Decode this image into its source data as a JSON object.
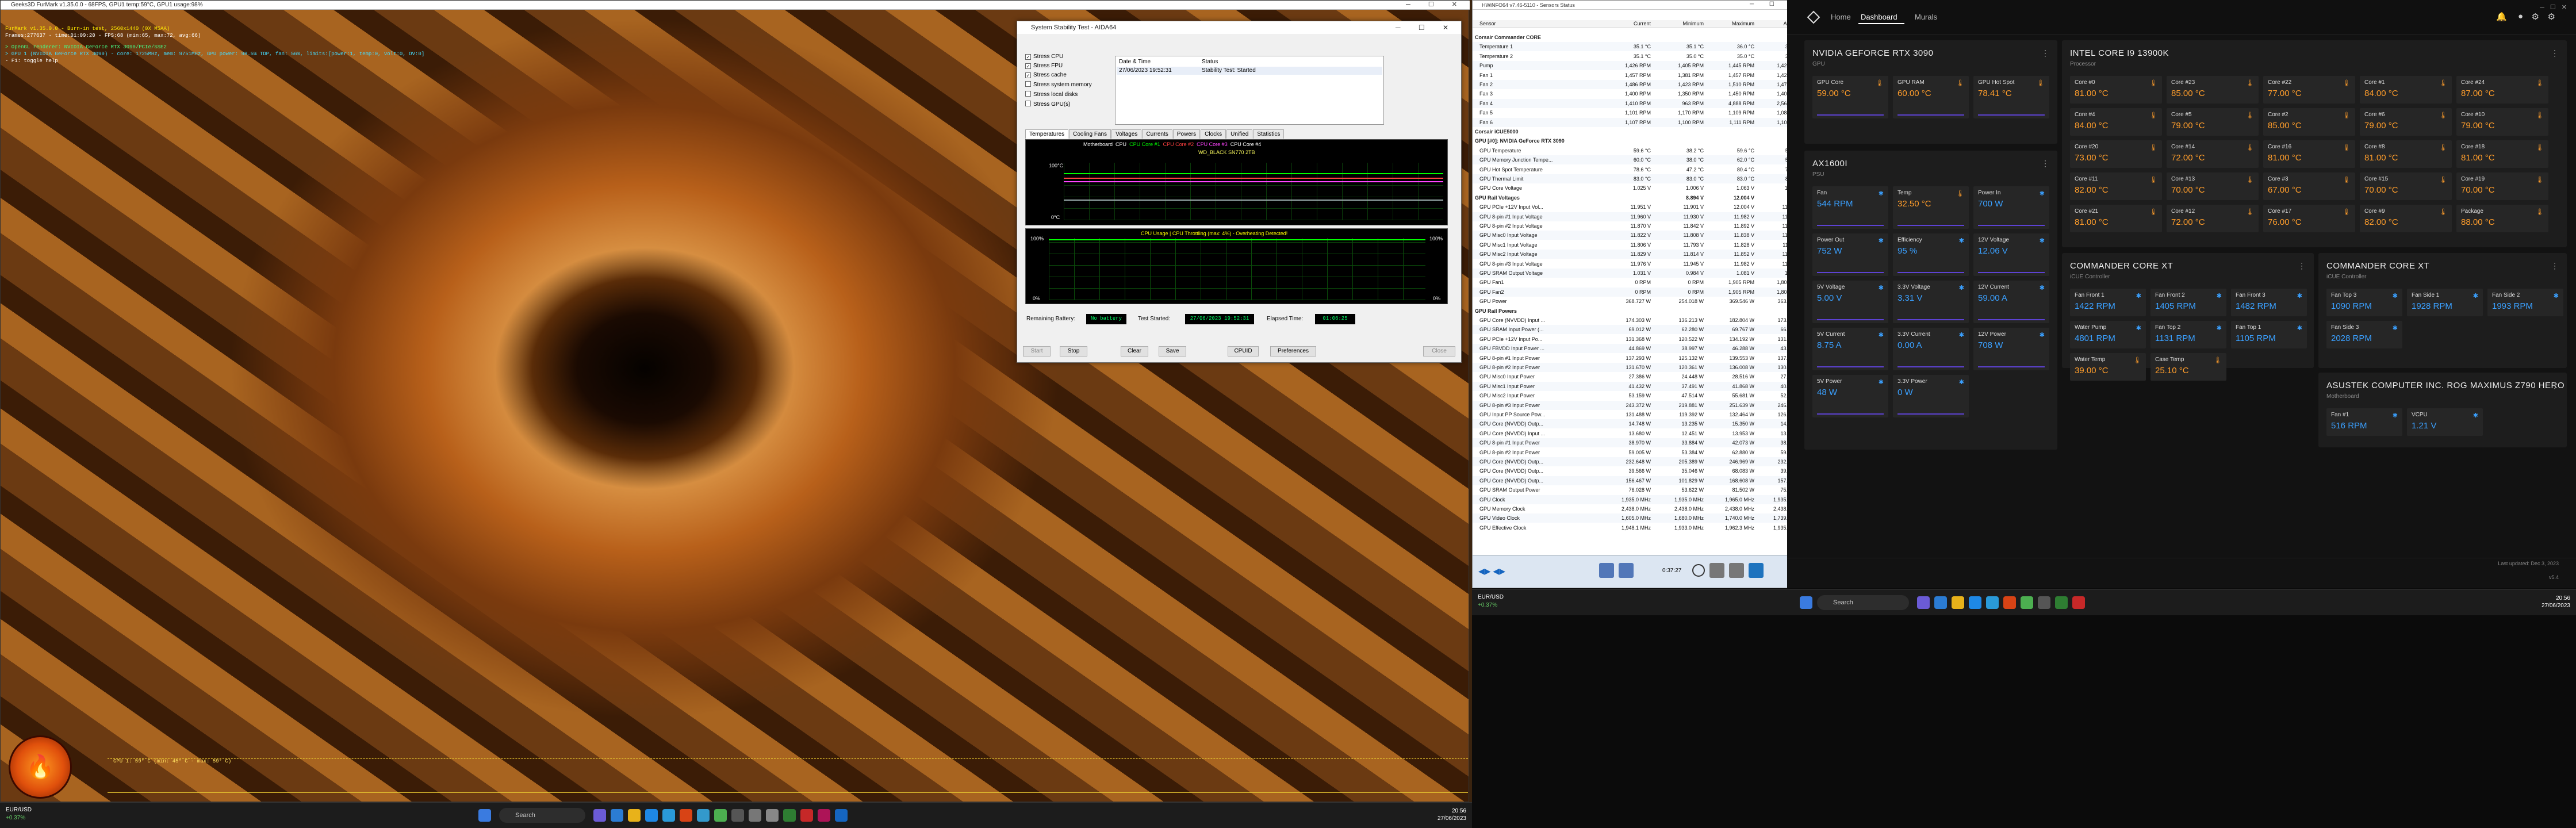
{
  "furmark": {
    "title": "Geeks3D FurMark v1.35.0.0 - 68FPS, GPU1 temp:59°C, GPU1 usage:98%",
    "info": [
      "FurMark v1.35.0.0 - Burn-in test, 2560x1440 (0X MSAA)",
      "Frames:277637 - time:01:09:20 - FPS:68 (min:65, max:72, avg:66)",
      "> OpenGL renderer: NVIDIA GeForce RTX 3090/PCIe/SSE2",
      "> GPU 1 (NVIDIA GeForce RTX 3090) - core: 1725MHz, mem: 9751MHz, GPU power: 98.5% TDP, fan: 56%, limits:[power:1, temp:0, volt:0, OV:0]",
      "- F1: toggle help"
    ],
    "graph_label": "GPU 1: 59° C (min: 45° C - max: 59° C)",
    "flame_icon": "furmark-flame-icon"
  },
  "taskbar1": {
    "weather_sym": "EUR/USD",
    "weather_val": "+0.37%",
    "search": "Search",
    "time": "20:56",
    "date": "27/06/2023"
  },
  "aida": {
    "title": "System Stability Test - AIDA64",
    "stress": [
      {
        "label": "Stress CPU",
        "checked": true
      },
      {
        "label": "Stress FPU",
        "checked": true
      },
      {
        "label": "Stress cache",
        "checked": true
      },
      {
        "label": "Stress system memory",
        "checked": false
      },
      {
        "label": "Stress local disks",
        "checked": false
      },
      {
        "label": "Stress GPU(s)",
        "checked": false
      }
    ],
    "status_head": [
      "Date & Time",
      "Status"
    ],
    "status_row": [
      "27/06/2023 19:52:31",
      "Stability Test: Started"
    ],
    "tabs": [
      "Temperatures",
      "Cooling Fans",
      "Voltages",
      "Currents",
      "Powers",
      "Clocks",
      "Unified",
      "Statistics"
    ],
    "graph1_legend": [
      "Motherboard",
      "CPU",
      "CPU Core #1",
      "CPU Core #2",
      "CPU Core #3",
      "CPU Core #4",
      "WD_BLACK SN770 2TB"
    ],
    "graph1_top": "100°C",
    "graph1_bottom": "0°C",
    "graph2_title": "CPU Usage | CPU Throttling (max: 4%) - Overheating Detected!",
    "graph2_top": "100%",
    "graph2_bottom": "0%",
    "graph2_top_r": "100%",
    "graph2_bottom_r": "0%",
    "remaining_label": "Remaining Battery:",
    "remaining": "No battery",
    "started_label": "Test Started:",
    "started": "27/06/2023 19:52:31",
    "elapsed_label": "Elapsed Time:",
    "elapsed": "01:06:25",
    "buttons": [
      "Start",
      "Stop",
      "Clear",
      "Save",
      "CPUID",
      "Preferences",
      "Close"
    ]
  },
  "hwinfo": {
    "title": "HWiNFO64 v7.46-5110 - Sensors Status",
    "cols": [
      "Sensor",
      "Current",
      "Minimum",
      "Maximum",
      "Average"
    ],
    "rows": [
      [
        "Corsair Commander CORE",
        "",
        "",
        "",
        ""
      ],
      [
        "Temperature 1",
        "35.1 °C",
        "35.1 °C",
        "36.0 °C",
        "35.6 °C"
      ],
      [
        "Temperature 2",
        "35.1 °C",
        "35.0 °C",
        "35.0 °C",
        "35.0 °C"
      ],
      [
        "Pump",
        "1,426 RPM",
        "1,405 RPM",
        "1,445 RPM",
        "1,425 RPM"
      ],
      [
        "Fan 1",
        "1,457 RPM",
        "1,381 RPM",
        "1,457 RPM",
        "1,422 RPM"
      ],
      [
        "Fan 2",
        "1,486 RPM",
        "1,423 RPM",
        "1,510 RPM",
        "1,478 RPM"
      ],
      [
        "Fan 3",
        "1,400 RPM",
        "1,350 RPM",
        "1,450 RPM",
        "1,406 RPM"
      ],
      [
        "Fan 4",
        "1,410 RPM",
        "963 RPM",
        "4,888 RPM",
        "2,567 RPM"
      ],
      [
        "Fan 5",
        "1,101 RPM",
        "1,170 RPM",
        "1,109 RPM",
        "1,084 RPM"
      ],
      [
        "Fan 6",
        "1,107 RPM",
        "1,100 RPM",
        "1,111 RPM",
        "1,106 RPM"
      ],
      [
        "Corsair iCUE5000",
        "",
        "",
        "",
        ""
      ],
      [
        "GPU [#0]: NVIDIA GeForce RTX 3090",
        "",
        "",
        "",
        ""
      ],
      [
        "GPU Temperature",
        "59.6 °C",
        "38.2 °C",
        "59.6 °C",
        "56.3 °C"
      ],
      [
        "GPU Memory Junction Tempe...",
        "60.0 °C",
        "38.0 °C",
        "62.0 °C",
        "58.1 °C"
      ],
      [
        "GPU Hot Spot Temperature",
        "78.6 °C",
        "47.2 °C",
        "80.4 °C",
        "75.8 °C"
      ],
      [
        "GPU Thermal Limit",
        "83.0 °C",
        "83.0 °C",
        "83.0 °C",
        "83.0 °C"
      ],
      [
        "GPU Core Voltage",
        "1.025 V",
        "1.006 V",
        "1.063 V",
        "1.048 V"
      ],
      [
        "GPU Rail Voltages",
        "",
        "8.894 V",
        "12.004 V",
        ""
      ],
      [
        "GPU PCIe +12V Input Vol...",
        "11.951 V",
        "11.901 V",
        "12.004 V",
        "11.965 V"
      ],
      [
        "GPU 8-pin #1 Input Voltage",
        "11.960 V",
        "11.930 V",
        "11.982 V",
        "11.957 V"
      ],
      [
        "GPU 8-pin #2 Input Voltage",
        "11.870 V",
        "11.842 V",
        "11.892 V",
        "11.868 V"
      ],
      [
        "GPU Misc0 Input Voltage",
        "11.822 V",
        "11.808 V",
        "11.838 V",
        "11.815 V"
      ],
      [
        "GPU Misc1 Input Voltage",
        "11.806 V",
        "11.793 V",
        "11.828 V",
        "11.811 V"
      ],
      [
        "GPU Misc2 Input Voltage",
        "11.829 V",
        "11.814 V",
        "11.852 V",
        "11.826 V"
      ],
      [
        "GPU 8-pin #3 Input Voltage",
        "11.976 V",
        "11.945 V",
        "11.982 V",
        "11.970 V"
      ],
      [
        "GPU SRAM Output Voltage",
        "1.031 V",
        "0.984 V",
        "1.081 V",
        "1.046 V"
      ],
      [
        "GPU Fan1",
        "0 RPM",
        "0 RPM",
        "1,905 RPM",
        "1,806 RPM"
      ],
      [
        "GPU Fan2",
        "0 RPM",
        "0 RPM",
        "1,905 RPM",
        "1,804 RPM"
      ],
      [
        "GPU Power",
        "368.727 W",
        "254.018 W",
        "369.546 W",
        "363.599 W"
      ],
      [
        "GPU Rail Powers",
        "",
        "",
        "",
        ""
      ],
      [
        "GPU Core (NVVDD) Input ...",
        "174.303 W",
        "136.213 W",
        "182.804 W",
        "173.307 W"
      ],
      [
        "GPU SRAM Input Power (...",
        "69.012 W",
        "62.280 W",
        "69.767 W",
        "66.888 W"
      ],
      [
        "GPU PCIe +12V Input Po...",
        "131.368 W",
        "120.522 W",
        "134.192 W",
        "131.223 W"
      ],
      [
        "GPU FBVDD Input Power ...",
        "44.869 W",
        "38.997 W",
        "46.288 W",
        "43.948 W"
      ],
      [
        "GPU 8-pin #1 Input Power",
        "137.293 W",
        "125.132 W",
        "139.553 W",
        "137.422 W"
      ],
      [
        "GPU 8-pin #2 Input Power",
        "131.670 W",
        "120.361 W",
        "136.008 W",
        "130.287 W"
      ],
      [
        "GPU Misc0 Input Power",
        "27.386 W",
        "24.448 W",
        "28.516 W",
        "27.028 W"
      ],
      [
        "GPU Misc1 Input Power",
        "41.432 W",
        "37.491 W",
        "41.868 W",
        "40.146 W"
      ],
      [
        "GPU Misc2 Input Power",
        "53.159 W",
        "47.514 W",
        "55.681 W",
        "52.771 W"
      ],
      [
        "GPU 8-pin #3 Input Power",
        "243.372 W",
        "219.881 W",
        "251.639 W",
        "246.809 W"
      ],
      [
        "GPU Input PP Source Pow...",
        "131.488 W",
        "119.392 W",
        "132.464 W",
        "126.230 W"
      ],
      [
        "GPU Core (NVVDD) Outp...",
        "14.748 W",
        "13.235 W",
        "15.350 W",
        "14.722 W"
      ],
      [
        "GPU Core (NVVDD) Input ...",
        "13.680 W",
        "12.451 W",
        "13.953 W",
        "13.577 W"
      ],
      [
        "GPU 8-pin #1 Input Power",
        "38.970 W",
        "33.884 W",
        "42.073 W",
        "38.808 W"
      ],
      [
        "GPU 8-pin #2 Input Power",
        "59.005 W",
        "53.384 W",
        "62.880 W",
        "59.007 W"
      ],
      [
        "GPU Core (NVVDD) Outp...",
        "232.648 W",
        "205.389 W",
        "246.969 W",
        "232.990 W"
      ],
      [
        "GPU Core (NVVDD) Outp...",
        "39.566 W",
        "35.046 W",
        "68.083 W",
        "39.909 W"
      ],
      [
        "GPU Core (NVVDD) Outp...",
        "156.467 W",
        "101.829 W",
        "168.608 W",
        "157.564 W"
      ],
      [
        "GPU SRAM Output Power",
        "76.028 W",
        "53.622 W",
        "81.502 W",
        "75.417 W"
      ],
      [
        "GPU Clock",
        "1,935.0 MHz",
        "1,935.0 MHz",
        "1,965.0 MHz",
        "1,935.0 MHz"
      ],
      [
        "GPU Memory Clock",
        "2,438.0 MHz",
        "2,438.0 MHz",
        "2,438.0 MHz",
        "2,438.0 MHz"
      ],
      [
        "GPU Video Clock",
        "1,605.0 MHz",
        "1,680.0 MHz",
        "1,740.0 MHz",
        "1,739.0 MHz"
      ],
      [
        "GPU Effective Clock",
        "1,948.1 MHz",
        "1,933.0 MHz",
        "1,962.3 MHz",
        "1,935.9 MHz"
      ]
    ],
    "foot_time": "0:37:27"
  },
  "taskbar2": {
    "weather_sym": "EUR/USD",
    "weather_val": "+0.37%",
    "search": "Search",
    "time": "20:56",
    "date": "27/06/2023"
  },
  "icue": {
    "nav": [
      "Home",
      "Dashboard",
      "Murals"
    ],
    "gpu_card": {
      "title": "NVIDIA GEFORCE RTX 3090",
      "sub": "GPU",
      "tiles": [
        {
          "l": "GPU Core",
          "v": "59.00 °C"
        },
        {
          "l": "GPU RAM",
          "v": "60.00 °C"
        },
        {
          "l": "GPU Hot Spot",
          "v": "78.41 °C"
        }
      ]
    },
    "cpu_card": {
      "title": "INTEL CORE I9 13900K",
      "sub": "Processor",
      "tiles": [
        {
          "l": "Core #0",
          "v": "81.00 °C"
        },
        {
          "l": "Core #23",
          "v": "85.00 °C"
        },
        {
          "l": "Core #22",
          "v": "77.00 °C"
        },
        {
          "l": "Core #1",
          "v": "84.00 °C"
        },
        {
          "l": "Core #24",
          "v": "87.00 °C"
        },
        {
          "l": "Core #4",
          "v": "84.00 °C"
        },
        {
          "l": "Core #5",
          "v": "79.00 °C"
        },
        {
          "l": "Core #2",
          "v": "85.00 °C"
        },
        {
          "l": "Core #6",
          "v": "79.00 °C"
        },
        {
          "l": "Core #10",
          "v": "79.00 °C"
        },
        {
          "l": "Core #20",
          "v": "73.00 °C"
        },
        {
          "l": "Core #14",
          "v": "72.00 °C"
        },
        {
          "l": "Core #16",
          "v": "81.00 °C"
        },
        {
          "l": "Core #8",
          "v": "81.00 °C"
        },
        {
          "l": "Core #18",
          "v": "81.00 °C"
        },
        {
          "l": "Core #11",
          "v": "82.00 °C"
        },
        {
          "l": "Core #13",
          "v": "70.00 °C"
        },
        {
          "l": "Core #3",
          "v": "67.00 °C"
        },
        {
          "l": "Core #15",
          "v": "70.00 °C"
        },
        {
          "l": "Core #19",
          "v": "70.00 °C"
        },
        {
          "l": "Core #21",
          "v": "81.00 °C"
        },
        {
          "l": "Core #12",
          "v": "72.00 °C"
        },
        {
          "l": "Core #17",
          "v": "76.00 °C"
        },
        {
          "l": "Core #9",
          "v": "82.00 °C"
        },
        {
          "l": "Package",
          "v": "88.00 °C"
        }
      ]
    },
    "psu_card": {
      "title": "AX1600I",
      "sub": "PSU",
      "tiles": [
        {
          "l": "Fan",
          "v": "544 RPM",
          "b": true
        },
        {
          "l": "Temp",
          "v": "32.50 °C"
        },
        {
          "l": "Power In",
          "v": "700 W",
          "b": true
        },
        {
          "l": "Power Out",
          "v": "752 W",
          "b": true
        },
        {
          "l": "Efficiency",
          "v": "95 %",
          "b": true
        },
        {
          "l": "12V Voltage",
          "v": "12.06 V",
          "b": true
        },
        {
          "l": "5V Voltage",
          "v": "5.00 V",
          "b": true
        },
        {
          "l": "3.3V Voltage",
          "v": "3.31 V",
          "b": true
        },
        {
          "l": "12V Current",
          "v": "59.00 A",
          "b": true
        },
        {
          "l": "5V Current",
          "v": "8.75 A",
          "b": true
        },
        {
          "l": "3.3V Current",
          "v": "0.00 A",
          "b": true
        },
        {
          "l": "12V Power",
          "v": "708 W",
          "b": true
        },
        {
          "l": "5V Power",
          "v": "48 W",
          "b": true
        },
        {
          "l": "3.3V Power",
          "v": "0 W",
          "b": true
        }
      ]
    },
    "cc1": {
      "title": "COMMANDER CORE XT",
      "sub": "iCUE Controller",
      "tiles": [
        {
          "l": "Fan Front 1",
          "v": "1422 RPM"
        },
        {
          "l": "Fan Front 2",
          "v": "1405 RPM"
        },
        {
          "l": "Fan Front 3",
          "v": "1482 RPM"
        },
        {
          "l": "Water Pump",
          "v": "4801 RPM"
        },
        {
          "l": "Fan Top 2",
          "v": "1131 RPM"
        },
        {
          "l": "Fan Top 1",
          "v": "1105 RPM"
        },
        {
          "l": "Water Temp",
          "v": "39.00 °C",
          "o": true
        },
        {
          "l": "Case Temp",
          "v": "25.10 °C",
          "o": true
        }
      ]
    },
    "cc2": {
      "title": "COMMANDER CORE XT",
      "sub": "iCUE Controller",
      "tiles": [
        {
          "l": "Fan Top 3",
          "v": "1090 RPM"
        },
        {
          "l": "Fan Side 1",
          "v": "1928 RPM"
        },
        {
          "l": "Fan Side 2",
          "v": "1993 RPM"
        },
        {
          "l": "Fan Side 3",
          "v": "2028 RPM"
        }
      ]
    },
    "mb": {
      "title": "ASUSTEK COMPUTER INC. ROG MAXIMUS Z790 HERO",
      "sub": "Motherboard",
      "tiles": [
        {
          "l": "Fan #1",
          "v": "516 RPM"
        },
        {
          "l": "VCPU",
          "v": "1.21 V"
        }
      ]
    },
    "footer_right": "Last updated: Dec 3, 2023",
    "footer_ver": "v5.4"
  },
  "taskbar3": {
    "weather_sym": "EUR/USD",
    "weather_val": "+0.37%",
    "search": "Search",
    "time": "20:56",
    "date": "27/06/2023"
  }
}
